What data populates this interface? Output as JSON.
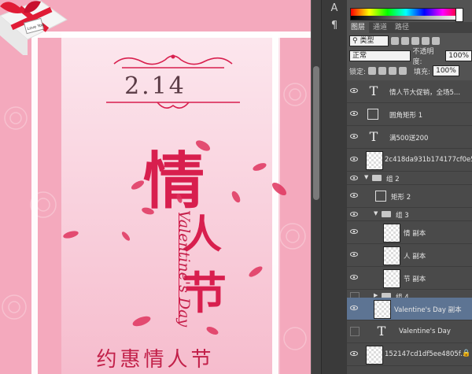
{
  "poster": {
    "date": "2.14",
    "char_qing": "情",
    "char_ren": "人",
    "char_jie": "节",
    "valentine_script": "Valentine's Day",
    "subtitle": "约惠情人节",
    "gift_tag": "Love You"
  },
  "panel": {
    "tabs": [
      "图层",
      "通道",
      "路径"
    ],
    "filter_kind": "类型",
    "blend_mode": "正常",
    "opacity_label": "不透明度:",
    "opacity_value": "100%",
    "lock_label": "锁定:",
    "fill_label": "填充:",
    "fill_value": "100%",
    "layers": [
      {
        "name": "情人节大促销，全场5...",
        "type": "text",
        "visible": true
      },
      {
        "name": "圆角矩形 1",
        "type": "shape",
        "visible": true
      },
      {
        "name": "满500送200",
        "type": "text",
        "visible": true
      },
      {
        "name": "2c418da931b174177cf0e5...",
        "type": "image",
        "visible": true
      },
      {
        "name": "组 2",
        "type": "group",
        "visible": true,
        "expanded": true
      },
      {
        "name": "矩形 2",
        "type": "shape",
        "visible": true
      },
      {
        "name": "组 3",
        "type": "group",
        "visible": true,
        "expanded": true
      },
      {
        "name": "情 副本",
        "type": "image",
        "visible": true
      },
      {
        "name": "人 副本",
        "type": "image",
        "visible": true
      },
      {
        "name": "节 副本",
        "type": "image",
        "visible": true
      },
      {
        "name": "组 4",
        "type": "group",
        "visible": false,
        "expanded": false
      },
      {
        "name": "Valentine's Day 副本",
        "type": "image",
        "visible": true,
        "selected": true
      },
      {
        "name": "Valentine's Day",
        "type": "text",
        "visible": false
      },
      {
        "name": "152147cd1df5ee4805f...",
        "type": "image",
        "visible": true
      }
    ]
  },
  "colors": {
    "accent": "#d81f4e",
    "panel_bg": "#535353",
    "selected_layer": "#5d7493"
  }
}
